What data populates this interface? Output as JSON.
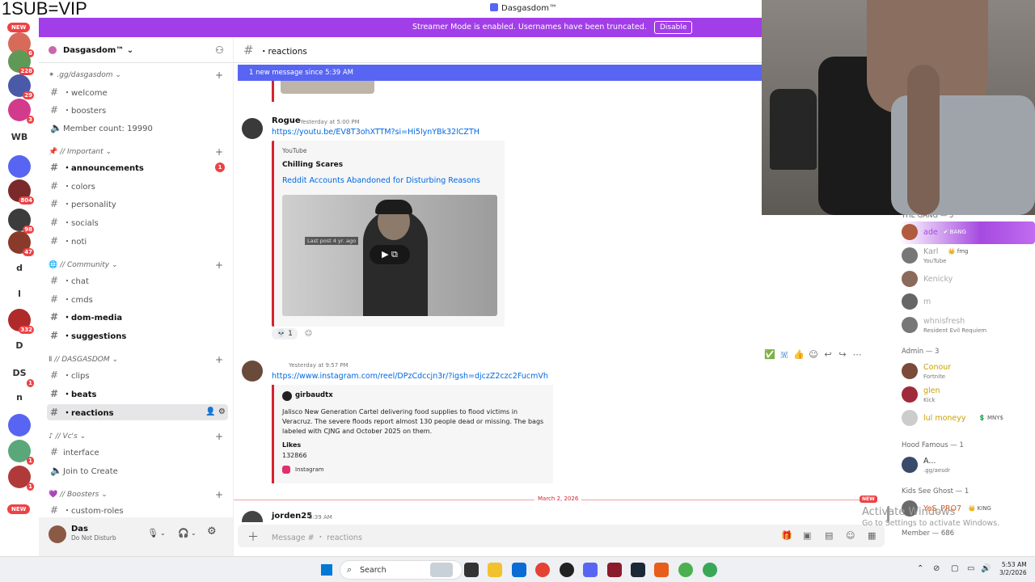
{
  "overlay_text": "1SUB=VIP",
  "window_title": "Dasgasdom™",
  "streamer_mode": {
    "message": "Streamer Mode is enabled. Usernames have been truncated.",
    "button": "Disable"
  },
  "rail": {
    "new_top": "NEW",
    "new_bottom": "NEW",
    "items": [
      {
        "label": "",
        "badge": "6",
        "color": "#d86a5a"
      },
      {
        "label": "",
        "badge": "228",
        "color": "#5e9a55"
      },
      {
        "label": "",
        "badge": "29",
        "color": "#4a5aa8"
      },
      {
        "label": "",
        "badge": "3",
        "color": "#d23b8c"
      },
      {
        "label": "WB",
        "badge": "",
        "color": ""
      },
      {
        "label": "",
        "badge": "",
        "color": "#5865f2"
      },
      {
        "label": "",
        "badge": "804",
        "color": "#7a2a2a"
      },
      {
        "label": "",
        "badge": "98",
        "color": "#3c3c3c"
      },
      {
        "label": "",
        "badge": "47",
        "color": "#8a3a2a"
      },
      {
        "label": "d",
        "badge": "",
        "color": ""
      },
      {
        "label": "l",
        "badge": "",
        "color": ""
      },
      {
        "label": "",
        "badge": "332",
        "color": "#b02a2a"
      },
      {
        "label": "D",
        "badge": "",
        "color": ""
      },
      {
        "label": "DS",
        "badge": "1",
        "color": ""
      },
      {
        "label": "n",
        "badge": "",
        "color": ""
      },
      {
        "label": "",
        "badge": "",
        "color": "#5865f2"
      },
      {
        "label": "",
        "badge": "1",
        "color": "#5aa87a"
      },
      {
        "label": "",
        "badge": "1",
        "color": "#b03a3a"
      }
    ]
  },
  "server": {
    "name": "Dasgasdom™"
  },
  "categories": [
    {
      "name": ".gg/dasgasdom",
      "channels": [
        {
          "name": "・welcome",
          "style": ""
        },
        {
          "name": "・boosters",
          "style": ""
        },
        {
          "name": "Member count: 19990",
          "style": "voice"
        }
      ]
    },
    {
      "name": "// Important",
      "channels": [
        {
          "name": "・announcements",
          "style": "bold",
          "unread": "1"
        },
        {
          "name": "・colors",
          "style": ""
        },
        {
          "name": "・personality",
          "style": ""
        },
        {
          "name": "・socials",
          "style": ""
        },
        {
          "name": "・noti",
          "style": ""
        }
      ]
    },
    {
      "name": "// Community",
      "channels": [
        {
          "name": "・chat",
          "style": ""
        },
        {
          "name": "・cmds",
          "style": ""
        },
        {
          "name": "・dom-media",
          "style": "bold"
        },
        {
          "name": "・suggestions",
          "style": "bold"
        }
      ]
    },
    {
      "name": "// DASGASDOM",
      "channels": [
        {
          "name": "・clips",
          "style": ""
        },
        {
          "name": "・beats",
          "style": "bold"
        },
        {
          "name": "・reactions",
          "style": "selected"
        }
      ]
    },
    {
      "name": "// Vc's",
      "channels": [
        {
          "name": "interface",
          "style": ""
        },
        {
          "name": "Join to Create",
          "style": "voice"
        }
      ]
    },
    {
      "name": "// Boosters",
      "channels": [
        {
          "name": "・custom-roles",
          "style": ""
        }
      ]
    }
  ],
  "user": {
    "name": "Das",
    "status": "Do Not Disturb"
  },
  "channel": {
    "name": "・reactions",
    "new_messages": "1 new message since 5:39 AM"
  },
  "messages": [
    {
      "author": "Rogue",
      "timestamp": "Yesterday at 5:00 PM",
      "link": "https://youtu.be/EV8T3ohXTTM?si=Hi5lynYBk32lCZTH",
      "embed": {
        "provider": "YouTube",
        "author": "Chilling Scares",
        "title": "Reddit Accounts Abandoned for Disturbing Reasons",
        "thumb_caption": "Last post 4 yr. ago"
      },
      "reaction_count": "1"
    },
    {
      "author": "",
      "timestamp": "Yesterday at 9:57 PM",
      "link": "https://www.instagram.com/reel/DPzCdccjn3r/?igsh=djczZ2czc2FucmVh",
      "embed": {
        "account": "girbaudtx",
        "description": "Jalisco New Generation Cartel delivering food supplies to flood victims in Veracruz. The severe floods report almost 130 people dead or missing. The bags labeled with CJNG and October 2025 on them.",
        "likes_label": "Likes",
        "likes_value": "132866",
        "footer": "Instagram"
      }
    },
    {
      "author": "jorden25",
      "timestamp": "5:39 AM"
    }
  ],
  "divider": {
    "date": "March 2, 2026",
    "tag": "NEW"
  },
  "composer": {
    "placeholder": "Message # ・ reactions"
  },
  "members": {
    "groups": [
      {
        "label": "THE GANG — 5",
        "items": [
          {
            "name": "ade",
            "status": "",
            "tag": "✔ BANG",
            "color": "#a64ae0",
            "avatar": "#b05a40",
            "hl": true
          },
          {
            "name": "Karl",
            "status": "YouTube",
            "tag": "👑 fmg",
            "color": "#999",
            "avatar": "#777"
          },
          {
            "name": "Kenicky",
            "status": "",
            "tag": "",
            "color": "#aaa",
            "avatar": "#8a6a5a"
          },
          {
            "name": "m",
            "status": "",
            "tag": "",
            "color": "#aaa",
            "avatar": "#666"
          },
          {
            "name": "whnisfresh",
            "status": "Resident Evil Requiem",
            "tag": "",
            "color": "#aaa",
            "avatar": "#777"
          }
        ]
      },
      {
        "label": "Admin — 3",
        "items": [
          {
            "name": "Conour",
            "status": "Fortnite",
            "tag": "",
            "color": "#c9a100",
            "avatar": "#7a4a3a"
          },
          {
            "name": "glen",
            "status": "Kick",
            "tag": "",
            "color": "#c9a100",
            "avatar": "#a02a3a"
          },
          {
            "name": "lul moneyy",
            "status": "",
            "tag": "💲 MNY$",
            "color": "#c9a100",
            "avatar": "#ccc"
          }
        ]
      },
      {
        "label": "Hood Famous — 1",
        "items": [
          {
            "name": "A...",
            "status": ".gg/aesdr",
            "tag": "",
            "color": "#333",
            "avatar": "#3a4a6a"
          }
        ]
      },
      {
        "label": "Kids See Ghost — 1",
        "items": [
          {
            "name": "YeS_PRO7",
            "status": "",
            "tag": "👑 KING",
            "color": "#d25a20",
            "avatar": "#6a6a6a"
          }
        ]
      },
      {
        "label": "Member — 686",
        "items": []
      }
    ]
  },
  "activate": {
    "title": "Activate Windows",
    "subtitle": "Go to Settings to activate Windows."
  },
  "taskbar": {
    "search": "Search",
    "time": "5:53 AM",
    "date": "3/2/2026"
  }
}
